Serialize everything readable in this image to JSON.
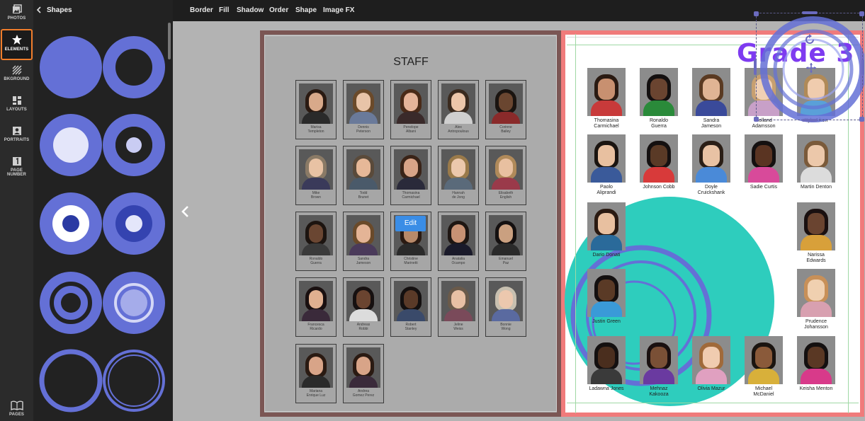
{
  "rail": {
    "items": [
      {
        "label": "PHOTOS",
        "icon": "photos-icon"
      },
      {
        "label": "ELEMENTS",
        "icon": "star-icon",
        "active": true
      },
      {
        "label": "BKGROUND",
        "icon": "background-icon"
      },
      {
        "label": "LAYOUTS",
        "icon": "layouts-icon"
      },
      {
        "label": "PORTRAITS",
        "icon": "portraits-icon"
      },
      {
        "label_line1": "PAGE",
        "label_line2": "NUMBER",
        "icon": "page-number-icon"
      },
      {
        "label": "PAGES",
        "icon": "pages-icon"
      }
    ]
  },
  "panel": {
    "title": "Shapes"
  },
  "toolbar": {
    "items": [
      "Border",
      "Fill",
      "Shadow",
      "Order",
      "Shape",
      "Image FX"
    ]
  },
  "staff_page": {
    "title": "STAFF",
    "edit_label": "Edit",
    "cards": [
      {
        "line1": "Marisa",
        "line2": "Templeton"
      },
      {
        "line1": "Dennis",
        "line2": "Peterson"
      },
      {
        "line1": "Penelope",
        "line2": "Albani"
      },
      {
        "line1": "Alex",
        "line2": "Antropoulous"
      },
      {
        "line1": "Corinne",
        "line2": "Bailey"
      },
      {
        "line1": "Mike",
        "line2": "Brown"
      },
      {
        "line1": "Todd",
        "line2": "Brunet"
      },
      {
        "line1": "Thomasina",
        "line2": "Carmichael"
      },
      {
        "line1": "Hannah",
        "line2": "de Jong"
      },
      {
        "line1": "Elisabeth",
        "line2": "English"
      },
      {
        "line1": "Ronaldo",
        "line2": "Guerra"
      },
      {
        "line1": "Sandra",
        "line2": "Jameson"
      },
      {
        "line1": "Christine",
        "line2": "Marinetti"
      },
      {
        "line1": "Anatalia",
        "line2": "Ocampo"
      },
      {
        "line1": "Emanuel",
        "line2": "Paz"
      },
      {
        "line1": "Francesca",
        "line2": "Ricardo"
      },
      {
        "line1": "Andreas",
        "line2": "Robbi"
      },
      {
        "line1": "Robert",
        "line2": "Stanley"
      },
      {
        "line1": "Jeline",
        "line2": "Weiss"
      },
      {
        "line1": "Bonnie",
        "line2": "Wong"
      },
      {
        "line1": "Mariana",
        "line2": "Enrique Luz"
      },
      {
        "line1": "Andrea",
        "line2": "Gomez Perez"
      }
    ]
  },
  "grade_page": {
    "title": "Grade 3",
    "students": [
      {
        "line1": "Thomasina",
        "line2": "Carmichael"
      },
      {
        "line1": "Ronaldo",
        "line2": "Guerra"
      },
      {
        "line1": "Sandra",
        "line2": "Jameson"
      },
      {
        "line1": "Holland",
        "line2": "Adamsson"
      },
      {
        "line1": "Kyle Aiken",
        "line2": ""
      },
      {
        "line1": "Paolo",
        "line2": "Aliprandi"
      },
      {
        "line1": "Johnson Cobb",
        "line2": ""
      },
      {
        "line1": "Doyle",
        "line2": "Cruickshank"
      },
      {
        "line1": "Sadie Curtis",
        "line2": ""
      },
      {
        "line1": "Martin Denton",
        "line2": ""
      },
      {
        "line1": "Dario Donati",
        "line2": ""
      },
      {
        "line1": "Narissa",
        "line2": "Edwards"
      },
      {
        "line1": "Justin Green",
        "line2": ""
      },
      {
        "line1": "Prudence",
        "line2": "Johansson"
      },
      {
        "line1": "Ladawna Jones",
        "line2": ""
      },
      {
        "line1": "Mehnaz",
        "line2": "Kakooza"
      },
      {
        "line1": "Olivia Mazur",
        "line2": ""
      },
      {
        "line1": "Michael",
        "line2": "McDaniel"
      },
      {
        "line1": "Keisha Menton",
        "line2": ""
      }
    ]
  },
  "colors": {
    "accent_orange": "#f07d2b",
    "shape_blue": "#6470d6",
    "teal": "#2ecdbd",
    "grade_purple": "#7e3bf0",
    "edit_blue": "#3a8de6",
    "page_border_pink": "#f07b7b"
  }
}
